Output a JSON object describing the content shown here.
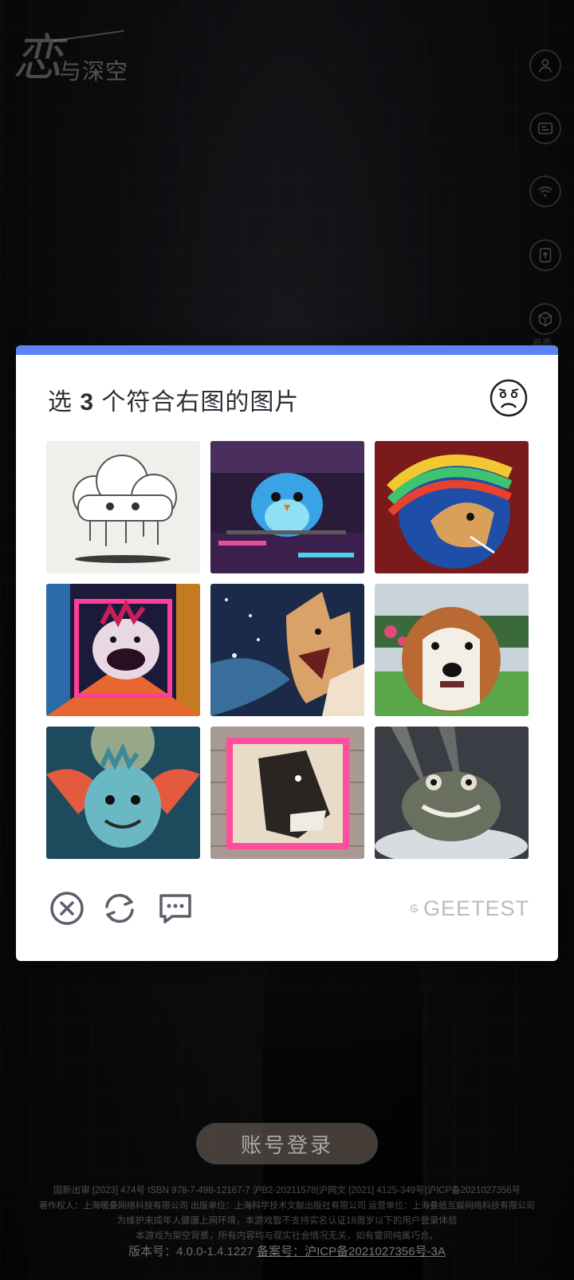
{
  "app": {
    "logo_big": "恋",
    "logo_small": "与深空"
  },
  "side_menu": {
    "items": [
      {
        "icon": "account-icon"
      },
      {
        "icon": "notice-icon"
      },
      {
        "icon": "network-icon"
      },
      {
        "icon": "upload-icon"
      },
      {
        "icon": "quality-icon",
        "label": "画质"
      }
    ]
  },
  "captcha": {
    "title_prefix": "选",
    "title_count": "3",
    "title_suffix": "个符合右图的图片",
    "reference_icon": "sad-face-icon",
    "tiles": [
      {
        "subject": "pixel cloud"
      },
      {
        "subject": "pixel blue bird"
      },
      {
        "subject": "pixel rainbow horse"
      },
      {
        "subject": "pixel neon monster"
      },
      {
        "subject": "pixel shouting wolf"
      },
      {
        "subject": "pixel angry dog"
      },
      {
        "subject": "pixel winged creature"
      },
      {
        "subject": "pixel horse portrait"
      },
      {
        "subject": "pixel grinning toad"
      }
    ],
    "brand": "GEETEST",
    "colors": {
      "accent": "#5b83f4",
      "icon": "#5a5f6a"
    }
  },
  "login": {
    "button_label": "账号登录"
  },
  "legal": {
    "line1": "国新出审 [2023] 474号  ISBN 978-7-498-12167-7  沪B2-20211578|沪网文 [2021] 4125-349号|沪ICP备2021027356号",
    "line2": "著作权人：上海暖叠网络科技有限公司  出版单位：上海科学技术文献出版社有限公司  运营单位：上海叠纸互娱网络科技有限公司",
    "line3": "为维护未成年人健康上网环境，本游戏暂不支持实名认证18周岁以下的用户登录体验",
    "line4": "本游戏为架空背景，所有内容均与现实社会情况无关，如有雷同纯属巧合。",
    "version_label": "版本号：4.0.0-1.4.1227",
    "record_label": "备案号：沪ICP备2021027356号-3A"
  }
}
